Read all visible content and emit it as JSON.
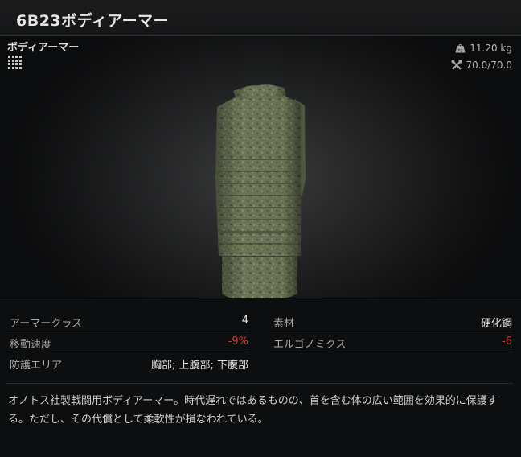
{
  "window": {
    "title": "6B23ボディアーマー"
  },
  "item": {
    "category": "ボディアーマー",
    "weight": "11.20 kg",
    "durability": "70.0/70.0",
    "icons": {
      "category_icon": "grid-icon",
      "weight_icon": "weight-icon",
      "durability_icon": "tools-icon"
    }
  },
  "stats": {
    "left": [
      {
        "label": "アーマークラス",
        "value": "4",
        "negative": false
      },
      {
        "label": "移動速度",
        "value": "-9%",
        "negative": true
      },
      {
        "label": "防護エリア",
        "value": "胸部; 上腹部; 下腹部",
        "negative": false
      }
    ],
    "right": [
      {
        "label": "素材",
        "value": "硬化鋼",
        "negative": false
      },
      {
        "label": "エルゴノミクス",
        "value": "-6",
        "negative": true
      }
    ]
  },
  "description": "オノトス社製戦闘用ボディアーマー。時代遅れではあるものの、首を含む体の広い範囲を効果的に保護する。ただし、その代償として柔軟性が損なわれている。",
  "colors": {
    "negative": "#d0413a",
    "background": "#0d0e0f",
    "text": "#d8d8d4"
  }
}
